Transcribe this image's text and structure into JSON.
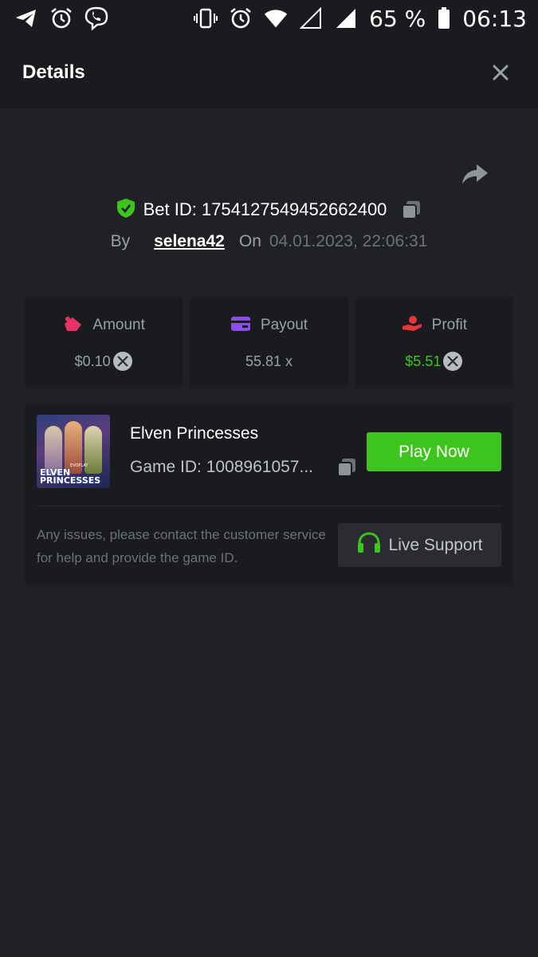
{
  "status_bar": {
    "battery_percent": "65 %",
    "time": "06:13",
    "icons": [
      "telegram-icon",
      "alarm-icon",
      "viber-icon",
      "vibrate-icon",
      "alarm-icon",
      "wifi-icon",
      "signal-empty-icon",
      "signal-icon",
      "battery-icon"
    ]
  },
  "header": {
    "title": "Details",
    "close_icon": "close-icon"
  },
  "bet": {
    "bet_id_label": "Bet ID: 1754127549452662400",
    "by_label": "By",
    "username": "selena42",
    "on_label": "On",
    "datetime": "04.01.2023, 22:06:31"
  },
  "stats": [
    {
      "label": "Amount",
      "value": "$0.10",
      "icon": "amount-icon",
      "icon_color": "#e8336a"
    },
    {
      "label": "Payout",
      "value": "55.81 x",
      "icon": "payout-card-icon",
      "icon_color": "#8a4df0"
    },
    {
      "label": "Profit",
      "value": "$5.51",
      "icon": "profit-hand-icon",
      "icon_color": "#e83535"
    }
  ],
  "game": {
    "title": "Elven Princesses",
    "game_id": "Game ID: 1008961057...",
    "thumb_logo": "ELVEN PRINCESSES",
    "thumb_brand": "EVOPLAY",
    "play_button": "Play Now",
    "help_text": "Any issues, please contact the customer service for help and provide the game ID.",
    "support_button": "Live Support"
  },
  "colors": {
    "background": "#202125",
    "panel": "#1a1b1e",
    "accent_green": "#3dc51e"
  }
}
